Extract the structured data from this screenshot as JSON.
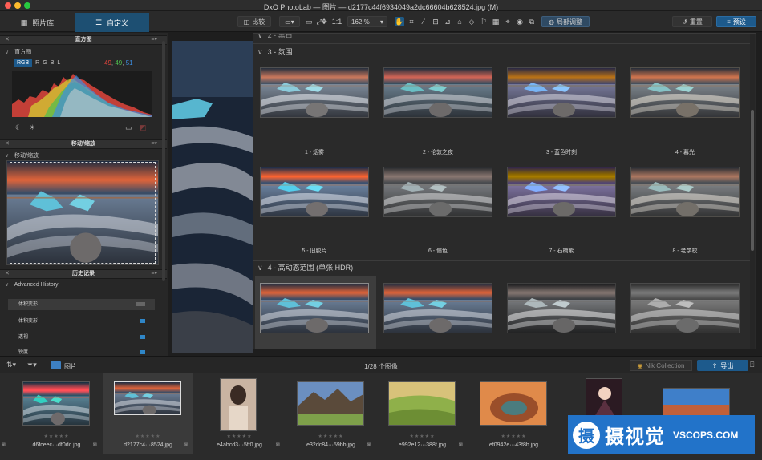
{
  "window": {
    "title": "DxO PhotoLab — 图片 — d2177c44f6934049a2dc66604b628524.jpg (M)"
  },
  "toolbar": {
    "tabs": [
      {
        "label": "照片库",
        "icon": "grid-icon"
      },
      {
        "label": "自定义",
        "icon": "sliders-icon"
      }
    ],
    "compare_label": "比较",
    "one_to_one": "1:1",
    "zoom": "162 %",
    "local_adjust_label": "局部调整",
    "reset_label": "重置",
    "presets_label": "预设"
  },
  "left_panel": {
    "histogram": {
      "header": "直方图",
      "sub": "直方图",
      "channels": [
        "RGB",
        "R",
        "G",
        "B",
        "L"
      ],
      "active_channel": "RGB",
      "values": {
        "r": "49",
        "g": "49",
        "b": "51"
      },
      "colors": {
        "r": "#e0453c",
        "g": "#4fbf4f",
        "b": "#3d8ee0"
      }
    },
    "move_zoom": {
      "header": "移动/缩放",
      "sub": "移动/缩放"
    },
    "history": {
      "header": "历史记录",
      "sub": "Advanced History",
      "items": [
        "体积变形",
        "体积变形",
        "透视",
        "锐度"
      ]
    }
  },
  "presets": {
    "top_partial": "2 - 黑白",
    "sections": [
      {
        "title": "3 - 氛围",
        "items": [
          "1 - 烟雾",
          "2 - 伦敦之夜",
          "3 - 蓝色时刻",
          "4 - 暮光",
          "5 - 旧胶片",
          "6 - 偏色",
          "7 - 石楠紫",
          "8 - 老学校"
        ]
      },
      {
        "title": "4 - 高动态范围 (单张 HDR)",
        "items": []
      }
    ]
  },
  "filmstrip": {
    "folder": "图片",
    "count": "1/28 个图像",
    "nik_label": "Nik Collection",
    "export_label": "导出",
    "items": [
      {
        "name": "d6fceec···df0dc.jpg"
      },
      {
        "name": "d2177c4···8524.jpg"
      },
      {
        "name": "e4abcd3···5ff0.jpg"
      },
      {
        "name": "e32dc84···59bb.jpg"
      },
      {
        "name": "e992e12···388f.jpg"
      },
      {
        "name": "ef0942e···43f8b.jpg"
      },
      {
        "name": ""
      },
      {
        "name": ""
      }
    ],
    "stars": "★★★★★"
  },
  "watermark": {
    "logo": "摄",
    "text": "摄视觉",
    "domain": "VSCOPS.COM"
  }
}
